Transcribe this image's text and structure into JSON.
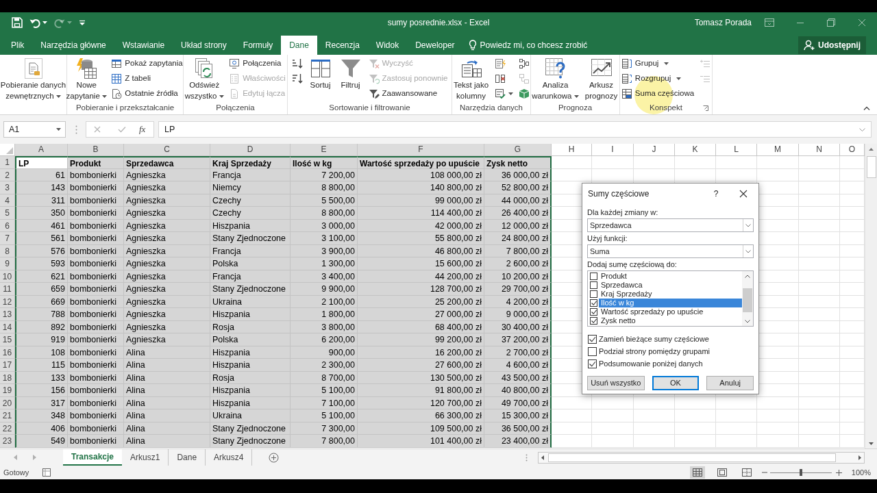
{
  "title_bar": {
    "quick_access": [
      {
        "kind": "save",
        "dropdown": false,
        "disabled": false
      },
      {
        "kind": "undo",
        "dropdown": true,
        "disabled": false
      },
      {
        "kind": "redo",
        "dropdown": true,
        "disabled": true
      },
      {
        "kind": "customize",
        "dropdown": false,
        "disabled": false
      }
    ],
    "title": "sumy posrednie.xlsx - Excel",
    "user": "Tomasz Porada"
  },
  "tabs": [
    {
      "label": "Plik",
      "selected": false
    },
    {
      "label": "Narzędzia główne",
      "selected": false
    },
    {
      "label": "Wstawianie",
      "selected": false
    },
    {
      "label": "Układ strony",
      "selected": false
    },
    {
      "label": "Formuły",
      "selected": false
    },
    {
      "label": "Dane",
      "selected": true
    },
    {
      "label": "Recenzja",
      "selected": false
    },
    {
      "label": "Widok",
      "selected": false
    },
    {
      "label": "Deweloper",
      "selected": false
    }
  ],
  "tell_me": "Powiedz mi, co chcesz zrobić",
  "share_button": "Udostępnij",
  "ribbon_groups": [
    {
      "items": [
        {
          "kind": "large",
          "label": "Pobieranie danych zewnętrznych",
          "dropdown": true,
          "disabled": false
        }
      ]
    },
    {
      "label": "Pobieranie i przekształcanie",
      "items": [
        {
          "kind": "large",
          "label": "Nowe zapytanie",
          "dropdown": true,
          "disabled": false
        },
        {
          "kind": "stack",
          "items": [
            {
              "kind": "small",
              "label": "Pokaż zapytania",
              "dropdown": false,
              "disabled": false
            },
            {
              "kind": "small",
              "label": "Z tabeli",
              "dropdown": false,
              "disabled": false
            },
            {
              "kind": "small",
              "label": "Ostatnie źródła",
              "dropdown": false,
              "disabled": false
            }
          ]
        }
      ]
    },
    {
      "label": "Połączenia",
      "items": [
        {
          "kind": "large",
          "label": "Odśwież wszystko",
          "dropdown": true,
          "disabled": false
        },
        {
          "kind": "stack",
          "items": [
            {
              "kind": "small",
              "label": "Połączenia",
              "dropdown": false,
              "disabled": false
            },
            {
              "kind": "small",
              "label": "Właściwości",
              "dropdown": false,
              "disabled": true
            },
            {
              "kind": "small",
              "label": "Edytuj łącza",
              "dropdown": false,
              "disabled": true
            }
          ]
        }
      ]
    },
    {
      "label": "Sortowanie i filtrowanie",
      "items": [
        {
          "kind": "stack",
          "items": [
            {
              "kind": "icon",
              "dropdown": false,
              "disabled": false
            },
            {
              "kind": "icon",
              "dropdown": false,
              "disabled": false
            }
          ]
        },
        {
          "kind": "large",
          "label": "Sortuj",
          "dropdown": false,
          "disabled": false
        },
        {
          "kind": "large",
          "label": "Filtruj",
          "dropdown": false,
          "disabled": false
        },
        {
          "kind": "stack",
          "items": [
            {
              "kind": "small",
              "label": "Wyczyść",
              "dropdown": false,
              "disabled": true
            },
            {
              "kind": "small",
              "label": "Zastosuj ponownie",
              "dropdown": false,
              "disabled": true
            },
            {
              "kind": "small",
              "label": "Zaawansowane",
              "dropdown": false,
              "disabled": false
            }
          ]
        }
      ]
    },
    {
      "label": "Narzędzia danych",
      "items": [
        {
          "kind": "large",
          "label": "Tekst jako kolumny",
          "dropdown": false,
          "disabled": false
        },
        {
          "kind": "stack",
          "items": [
            {
              "kind": "icon",
              "dropdown": false,
              "disabled": false
            },
            {
              "kind": "icon",
              "dropdown": false,
              "disabled": false
            },
            {
              "kind": "icon",
              "dropdown": true,
              "disabled": false
            }
          ]
        },
        {
          "kind": "stack",
          "items": [
            {
              "kind": "icon",
              "dropdown": false,
              "disabled": false
            },
            {
              "kind": "icon",
              "dropdown": false,
              "disabled": true
            },
            {
              "kind": "icon",
              "dropdown": false,
              "disabled": false
            }
          ]
        }
      ]
    },
    {
      "label": "Prognoza",
      "items": [
        {
          "kind": "large",
          "label": "Analiza warunkowa",
          "dropdown": true,
          "disabled": false
        },
        {
          "kind": "large",
          "label": "Arkusz prognozy",
          "dropdown": false,
          "disabled": false
        }
      ]
    },
    {
      "label": "Konspekt",
      "launcher": true,
      "items": [
        {
          "kind": "stack",
          "items": [
            {
              "kind": "small",
              "label": "Grupuj",
              "dropdown": true,
              "disabled": false
            },
            {
              "kind": "small",
              "label": "Rozgrupuj",
              "dropdown": true,
              "disabled": false
            },
            {
              "kind": "small",
              "label": "Suma częściowa",
              "dropdown": false,
              "disabled": false
            }
          ]
        },
        {
          "kind": "stack",
          "items": [
            {
              "kind": "icon",
              "dropdown": false,
              "disabled": true
            },
            {
              "kind": "icon",
              "dropdown": false,
              "disabled": true
            }
          ]
        }
      ]
    }
  ],
  "formula_bar": {
    "name_box": "A1",
    "function_label": "fx",
    "formula": "LP"
  },
  "sheet": {
    "columns": [
      {
        "label": "A",
        "selected": true,
        "active": true,
        "numeric": true
      },
      {
        "label": "B",
        "selected": true,
        "active": false,
        "numeric": false
      },
      {
        "label": "C",
        "selected": true,
        "active": false,
        "numeric": false
      },
      {
        "label": "D",
        "selected": true,
        "active": false,
        "numeric": false
      },
      {
        "label": "E",
        "selected": true,
        "active": false,
        "numeric": true
      },
      {
        "label": "F",
        "selected": true,
        "active": false,
        "numeric": true
      },
      {
        "label": "G",
        "selected": true,
        "active": false,
        "numeric": true
      },
      {
        "label": "H",
        "selected": false,
        "active": false
      },
      {
        "label": "I",
        "selected": false,
        "active": false
      },
      {
        "label": "J",
        "selected": false,
        "active": false
      },
      {
        "label": "K",
        "selected": false,
        "active": false
      },
      {
        "label": "L",
        "selected": false,
        "active": false
      },
      {
        "label": "M",
        "selected": false,
        "active": false
      },
      {
        "label": "N",
        "selected": false,
        "active": false
      },
      {
        "label": "O",
        "selected": false,
        "active": false
      }
    ],
    "rows": [
      {
        "label": "1",
        "kind": "header",
        "selected": true,
        "active": true,
        "cells": [
          "LP",
          "Produkt",
          "Sprzedawca",
          "Kraj Sprzedaży",
          "Ilość w kg",
          "Wartość sprzedaży po upuście",
          "Zysk netto"
        ]
      },
      {
        "label": "2",
        "kind": "data",
        "selected": true,
        "active": false,
        "cells": [
          "61",
          "bombonierki",
          "Agnieszka",
          "Francja",
          "7 200,00",
          "108 000,00 zł",
          "36 000,00 zł"
        ]
      },
      {
        "label": "3",
        "kind": "data",
        "selected": true,
        "active": false,
        "cells": [
          "143",
          "bombonierki",
          "Agnieszka",
          "Niemcy",
          "8 800,00",
          "140 800,00 zł",
          "52 800,00 zł"
        ]
      },
      {
        "label": "4",
        "kind": "data",
        "selected": true,
        "active": false,
        "cells": [
          "311",
          "bombonierki",
          "Agnieszka",
          "Czechy",
          "5 500,00",
          "99 000,00 zł",
          "44 000,00 zł"
        ]
      },
      {
        "label": "5",
        "kind": "data",
        "selected": true,
        "active": false,
        "cells": [
          "350",
          "bombonierki",
          "Agnieszka",
          "Czechy",
          "8 800,00",
          "114 400,00 zł",
          "26 400,00 zł"
        ]
      },
      {
        "label": "6",
        "kind": "data",
        "selected": true,
        "active": false,
        "cells": [
          "461",
          "bombonierki",
          "Agnieszka",
          "Hiszpania",
          "3 000,00",
          "42 000,00 zł",
          "12 000,00 zł"
        ]
      },
      {
        "label": "7",
        "kind": "data",
        "selected": true,
        "active": false,
        "cells": [
          "561",
          "bombonierki",
          "Agnieszka",
          "Stany Zjednoczone",
          "3 100,00",
          "55 800,00 zł",
          "24 800,00 zł"
        ]
      },
      {
        "label": "8",
        "kind": "data",
        "selected": true,
        "active": false,
        "cells": [
          "576",
          "bombonierki",
          "Agnieszka",
          "Francja",
          "3 900,00",
          "46 800,00 zł",
          "7 800,00 zł"
        ]
      },
      {
        "label": "9",
        "kind": "data",
        "selected": true,
        "active": false,
        "cells": [
          "593",
          "bombonierki",
          "Agnieszka",
          "Polska",
          "1 300,00",
          "15 600,00 zł",
          "2 600,00 zł"
        ]
      },
      {
        "label": "10",
        "kind": "data",
        "selected": true,
        "active": false,
        "cells": [
          "621",
          "bombonierki",
          "Agnieszka",
          "Francja",
          "3 400,00",
          "44 200,00 zł",
          "10 200,00 zł"
        ]
      },
      {
        "label": "11",
        "kind": "data",
        "selected": true,
        "active": false,
        "cells": [
          "659",
          "bombonierki",
          "Agnieszka",
          "Stany Zjednoczone",
          "9 900,00",
          "128 700,00 zł",
          "29 700,00 zł"
        ]
      },
      {
        "label": "12",
        "kind": "data",
        "selected": true,
        "active": false,
        "cells": [
          "669",
          "bombonierki",
          "Agnieszka",
          "Ukraina",
          "2 100,00",
          "25 200,00 zł",
          "4 200,00 zł"
        ]
      },
      {
        "label": "13",
        "kind": "data",
        "selected": true,
        "active": false,
        "cells": [
          "788",
          "bombonierki",
          "Agnieszka",
          "Hiszpania",
          "1 800,00",
          "27 000,00 zł",
          "9 000,00 zł"
        ]
      },
      {
        "label": "14",
        "kind": "data",
        "selected": true,
        "active": false,
        "cells": [
          "892",
          "bombonierki",
          "Agnieszka",
          "Rosja",
          "3 800,00",
          "68 400,00 zł",
          "30 400,00 zł"
        ]
      },
      {
        "label": "15",
        "kind": "data",
        "selected": true,
        "active": false,
        "cells": [
          "919",
          "bombonierki",
          "Agnieszka",
          "Polska",
          "6 200,00",
          "99 200,00 zł",
          "37 200,00 zł"
        ]
      },
      {
        "label": "16",
        "kind": "data",
        "selected": true,
        "active": false,
        "cells": [
          "108",
          "bombonierki",
          "Alina",
          "Hiszpania",
          "900,00",
          "16 200,00 zł",
          "2 700,00 zł"
        ]
      },
      {
        "label": "17",
        "kind": "data",
        "selected": true,
        "active": false,
        "cells": [
          "115",
          "bombonierki",
          "Alina",
          "Hiszpania",
          "2 300,00",
          "27 600,00 zł",
          "4 600,00 zł"
        ]
      },
      {
        "label": "18",
        "kind": "data",
        "selected": true,
        "active": false,
        "cells": [
          "133",
          "bombonierki",
          "Alina",
          "Rosja",
          "8 700,00",
          "130 500,00 zł",
          "43 500,00 zł"
        ]
      },
      {
        "label": "19",
        "kind": "data",
        "selected": true,
        "active": false,
        "cells": [
          "156",
          "bombonierki",
          "Alina",
          "Hiszpania",
          "5 100,00",
          "91 800,00 zł",
          "40 800,00 zł"
        ]
      },
      {
        "label": "20",
        "kind": "data",
        "selected": true,
        "active": false,
        "cells": [
          "317",
          "bombonierki",
          "Alina",
          "Hiszpania",
          "7 100,00",
          "120 700,00 zł",
          "49 700,00 zł"
        ]
      },
      {
        "label": "21",
        "kind": "data",
        "selected": true,
        "active": false,
        "cells": [
          "348",
          "bombonierki",
          "Alina",
          "Ukraina",
          "5 100,00",
          "66 300,00 zł",
          "15 300,00 zł"
        ]
      },
      {
        "label": "22",
        "kind": "data",
        "selected": true,
        "active": false,
        "cells": [
          "406",
          "bombonierki",
          "Alina",
          "Stany Zjednoczone",
          "7 300,00",
          "109 500,00 zł",
          "36 500,00 zł"
        ]
      },
      {
        "label": "23",
        "kind": "data",
        "selected": true,
        "active": false,
        "cells": [
          "549",
          "bombonierki",
          "Alina",
          "Stany Zjednoczone",
          "7 800,00",
          "101 400,00 zł",
          "23 400,00 zł"
        ]
      }
    ]
  },
  "dialog": {
    "title": "Sumy częściowe",
    "help": "?",
    "fields": [
      {
        "label": "Dla każdej zmiany w:",
        "value": "Sprzedawca"
      },
      {
        "label": "Użyj funkcji:",
        "value": "Suma"
      }
    ],
    "list_label": "Dodaj sumę częściową do:",
    "list": [
      {
        "label": "Produkt",
        "checked": false,
        "selected": false
      },
      {
        "label": "Sprzedawca",
        "checked": false,
        "selected": false
      },
      {
        "label": "Kraj Sprzedaży",
        "checked": false,
        "selected": false
      },
      {
        "label": "Ilość w kg",
        "checked": true,
        "selected": true
      },
      {
        "label": "Wartość sprzedaży po upuście",
        "checked": true,
        "selected": false
      },
      {
        "label": "Zysk netto",
        "checked": true,
        "selected": false
      }
    ],
    "options": [
      {
        "label": "Zamień bieżące sumy częściowe",
        "checked": true
      },
      {
        "label": "Podział strony pomiędzy grupami",
        "checked": false
      },
      {
        "label": "Podsumowanie poniżej danych",
        "checked": true
      }
    ],
    "buttons": [
      {
        "label": "Usuń wszystko",
        "default": false
      },
      {
        "label": "OK",
        "default": true
      },
      {
        "label": "Anuluj",
        "default": false
      }
    ]
  },
  "sheet_tabs": [
    {
      "label": "Transakcje",
      "selected": true
    },
    {
      "label": "Arkusz1",
      "selected": false
    },
    {
      "label": "Dane",
      "selected": false
    },
    {
      "label": "Arkusz4",
      "selected": false
    }
  ],
  "status_bar": {
    "text": "Gotowy",
    "views": [
      {
        "kind": "normal",
        "selected": true
      },
      {
        "kind": "page_layout",
        "selected": false
      },
      {
        "kind": "page_break",
        "selected": false
      }
    ],
    "zoom": {
      "level": 0.5,
      "reading": "100%"
    }
  }
}
